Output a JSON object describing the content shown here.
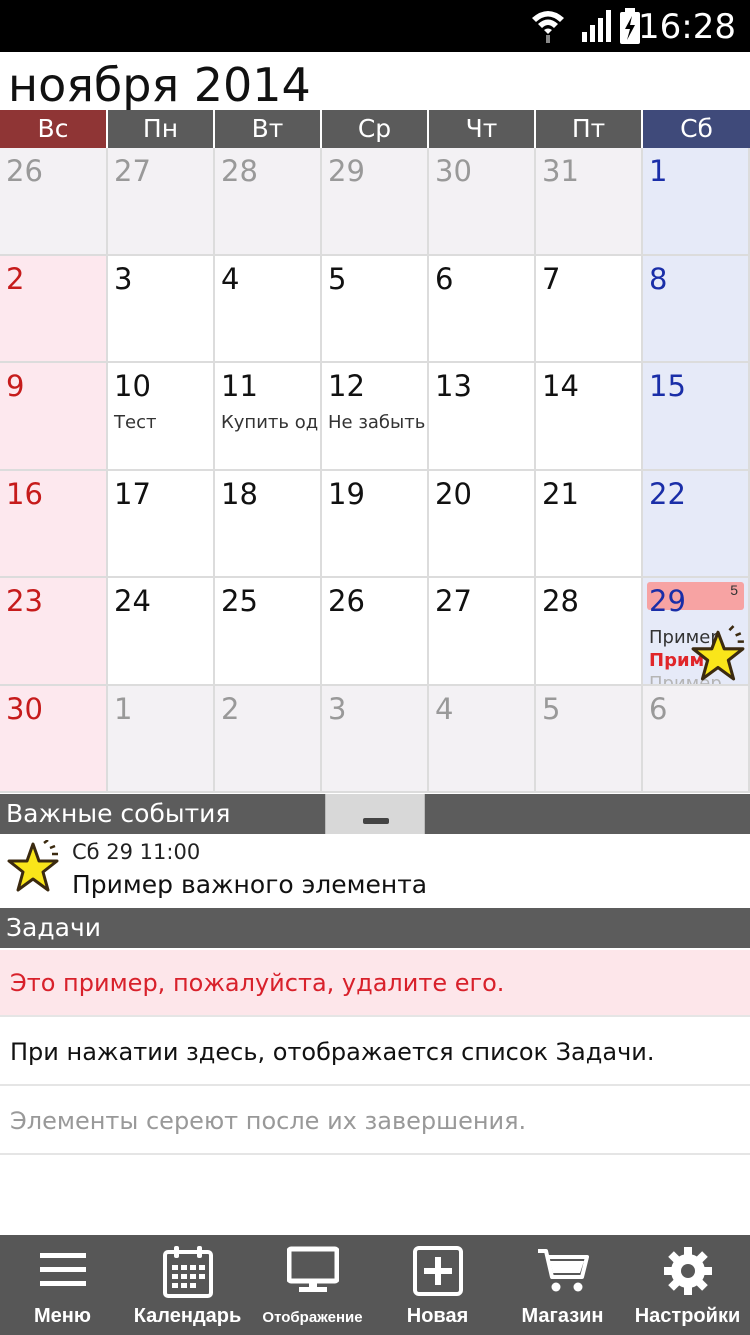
{
  "status_bar": {
    "time": "16:28",
    "icons": [
      "wifi-icon",
      "signal-icon",
      "battery-icon"
    ]
  },
  "month_title": "ноября 2014",
  "weekdays": [
    "Вс",
    "Пн",
    "Вт",
    "Ср",
    "Чт",
    "Пт",
    "Сб"
  ],
  "weeks": [
    [
      {
        "d": "26",
        "other": true
      },
      {
        "d": "27",
        "other": true
      },
      {
        "d": "28",
        "other": true
      },
      {
        "d": "29",
        "other": true
      },
      {
        "d": "30",
        "other": true
      },
      {
        "d": "31",
        "other": true
      },
      {
        "d": "1"
      }
    ],
    [
      {
        "d": "2"
      },
      {
        "d": "3"
      },
      {
        "d": "4"
      },
      {
        "d": "5"
      },
      {
        "d": "6"
      },
      {
        "d": "7"
      },
      {
        "d": "8"
      }
    ],
    [
      {
        "d": "9"
      },
      {
        "d": "10",
        "events": [
          "Тест"
        ]
      },
      {
        "d": "11",
        "events": [
          "Купить од"
        ]
      },
      {
        "d": "12",
        "events": [
          "Не забыть"
        ]
      },
      {
        "d": "13"
      },
      {
        "d": "14"
      },
      {
        "d": "15"
      }
    ],
    [
      {
        "d": "16"
      },
      {
        "d": "17"
      },
      {
        "d": "18"
      },
      {
        "d": "19"
      },
      {
        "d": "20"
      },
      {
        "d": "21"
      },
      {
        "d": "22"
      }
    ],
    [
      {
        "d": "23"
      },
      {
        "d": "24"
      },
      {
        "d": "25"
      },
      {
        "d": "26"
      },
      {
        "d": "27"
      },
      {
        "d": "28"
      },
      {
        "d": "29",
        "highlight": true,
        "badge": "5",
        "star": true,
        "events": [
          "Пример",
          "Прим",
          "Пример"
        ]
      }
    ],
    [
      {
        "d": "30"
      },
      {
        "d": "1",
        "other": true
      },
      {
        "d": "2",
        "other": true
      },
      {
        "d": "3",
        "other": true
      },
      {
        "d": "4",
        "other": true
      },
      {
        "d": "5",
        "other": true
      },
      {
        "d": "6",
        "other": true
      }
    ]
  ],
  "important": {
    "header": "Важные события",
    "date": "Сб 29 11:00",
    "title": "Пример важного элемента"
  },
  "tasks": {
    "header": "Задачи",
    "items": [
      "Это пример, пожалуйста, удалите его.",
      "При нажатии здесь, отображается список Задачи.",
      "Элементы сереют после их завершения."
    ]
  },
  "nav": [
    {
      "label": "Меню",
      "icon": "menu-icon"
    },
    {
      "label": "Календарь",
      "icon": "calendar-icon"
    },
    {
      "label": "Отображение",
      "icon": "display-icon"
    },
    {
      "label": "Новая",
      "icon": "add-icon"
    },
    {
      "label": "Магазин",
      "icon": "cart-icon"
    },
    {
      "label": "Настройки",
      "icon": "gear-icon"
    }
  ],
  "colors": {
    "sunday": "#c61b1b",
    "saturday": "#1a2ea8",
    "header": "#5c5c5c",
    "task_highlight": "#fde6ea"
  }
}
